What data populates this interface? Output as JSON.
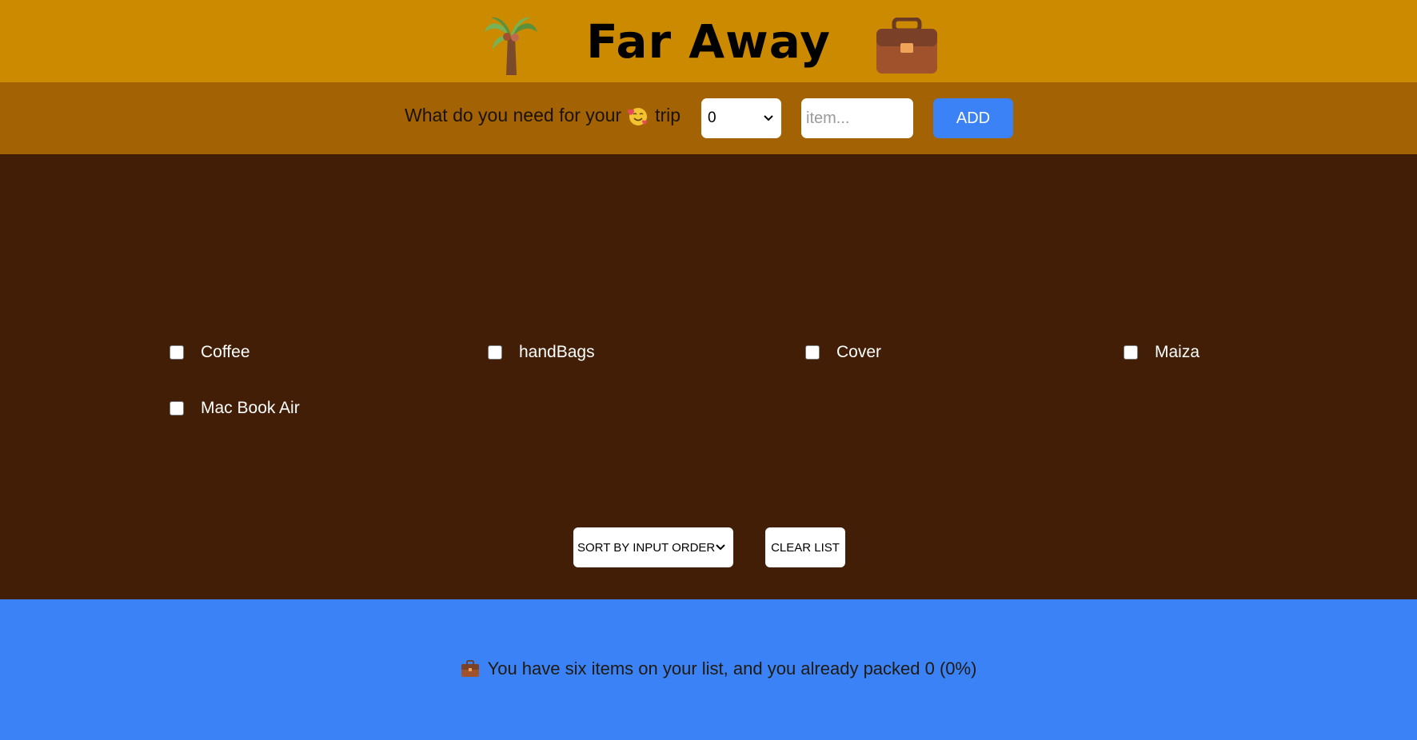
{
  "header": {
    "title": "Far Away",
    "left_icon": "palm-tree-icon",
    "right_icon": "briefcase-icon"
  },
  "form": {
    "label_before": "What do you need for your",
    "label_emoji": "smiling-face-with-hearts-icon",
    "label_after": "trip",
    "quantity_selected": "0",
    "item_placeholder": "item...",
    "item_value": "",
    "add_label": "ADD"
  },
  "list": {
    "items": [
      {
        "label": "Coffee",
        "packed": false
      },
      {
        "label": "handBags",
        "packed": false
      },
      {
        "label": "Cover",
        "packed": false
      },
      {
        "label": "Maiza",
        "packed": false
      },
      {
        "label": "Mac Book Air",
        "packed": false
      }
    ],
    "sort_selected": "SORT BY INPUT ORDER",
    "clear_label": "CLEAR LIST"
  },
  "stats": {
    "icon": "briefcase-icon",
    "text": "You have six items on your list, and you already packed 0 (0%)"
  },
  "colors": {
    "header_bg": "#cc8a00",
    "form_bg": "#a36304",
    "list_bg": "#411e05",
    "stats_bg": "#3b82f6",
    "accent": "#3b82f6"
  }
}
